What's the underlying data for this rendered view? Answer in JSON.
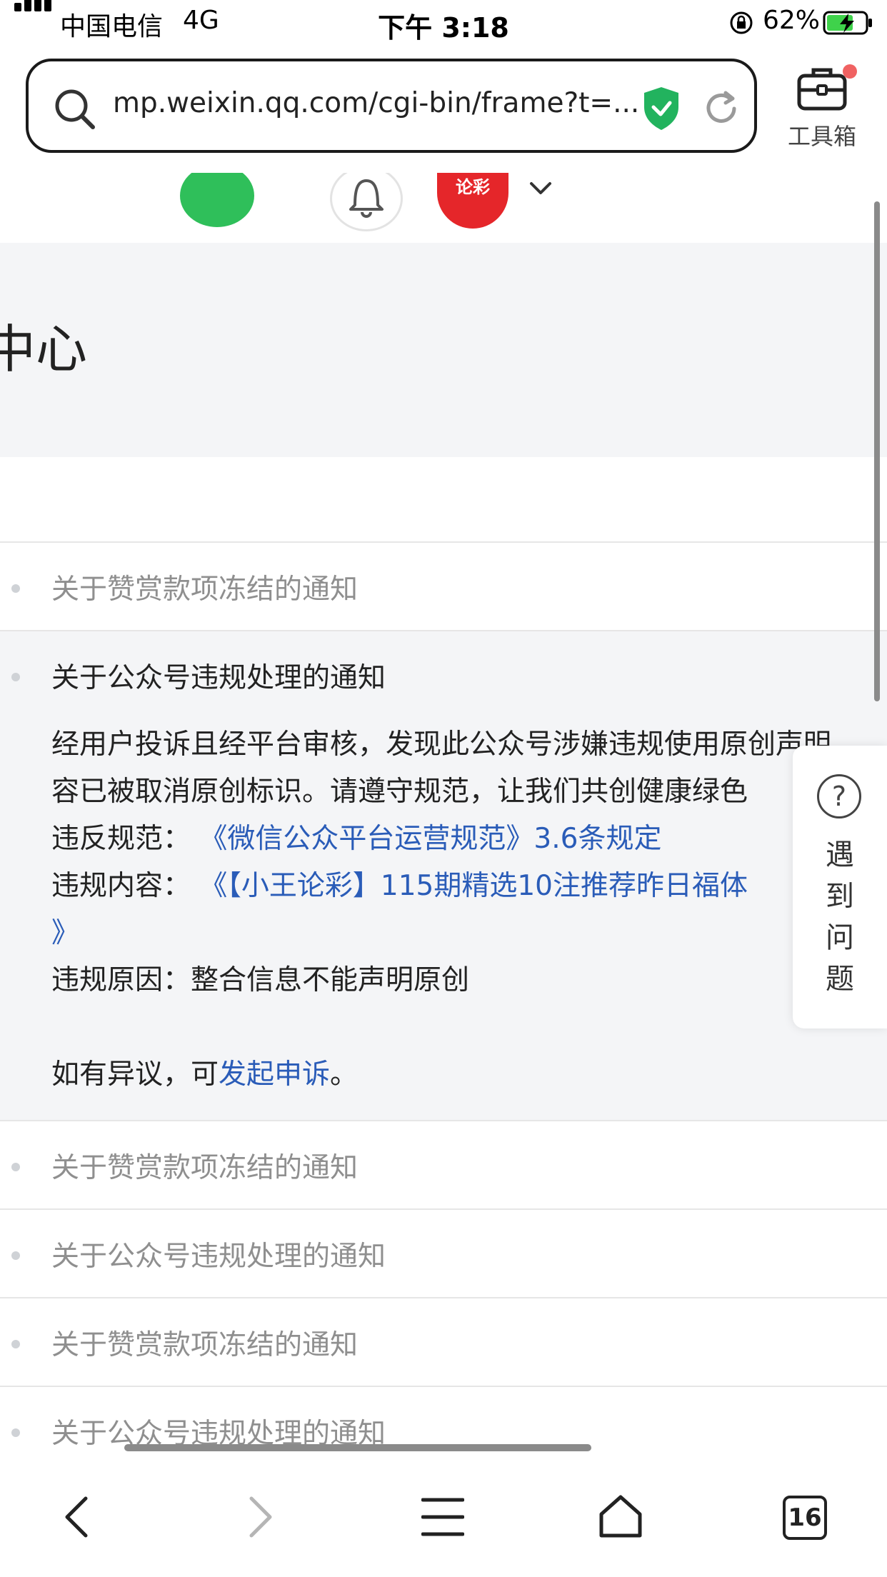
{
  "status_bar": {
    "carrier": "中国电信",
    "network": "4G",
    "time": "下午 3:18",
    "battery": "62%"
  },
  "browser": {
    "url": "mp.weixin.qq.com/cgi-bin/frame?t=...",
    "toolbox_label": "工具箱",
    "tab_count": "16"
  },
  "page": {
    "avatar_text": "论彩",
    "title_fragment": "中心"
  },
  "notifications": [
    {
      "title": "关于赞赏款项冻结的通知"
    },
    {
      "title": "关于公众号违规处理的通知",
      "body_line1": "经用户投诉且经平台审核，发现此公众号涉嫌违规使用原创声明",
      "body_line2": "容已被取消原创标识。请遵守规范，让我们共创健康绿色",
      "rule_label": "违反规范：",
      "rule_link": "《微信公众平台运营规范》3.6条规定",
      "content_label": "违规内容：",
      "content_link": "《【小王论彩】115期精选10注推荐昨日福体",
      "content_link_end": "》",
      "reason_label": "违规原因：",
      "reason_value": "整合信息不能声明原创",
      "appeal_prefix": "如有异议，可",
      "appeal_link": "发起申诉",
      "appeal_suffix": "。"
    },
    {
      "title": "关于赞赏款项冻结的通知"
    },
    {
      "title": "关于公众号违规处理的通知"
    },
    {
      "title": "关于赞赏款项冻结的通知"
    },
    {
      "title": "关于公众号违规处理的通知"
    }
  ],
  "help": {
    "icon": "?",
    "chars": [
      "遇",
      "到",
      "问",
      "题"
    ]
  },
  "colors": {
    "link": "#2a5cb8",
    "shield": "#22b35e",
    "wechat": "#2fbf5a",
    "avatar": "#e5262a"
  }
}
